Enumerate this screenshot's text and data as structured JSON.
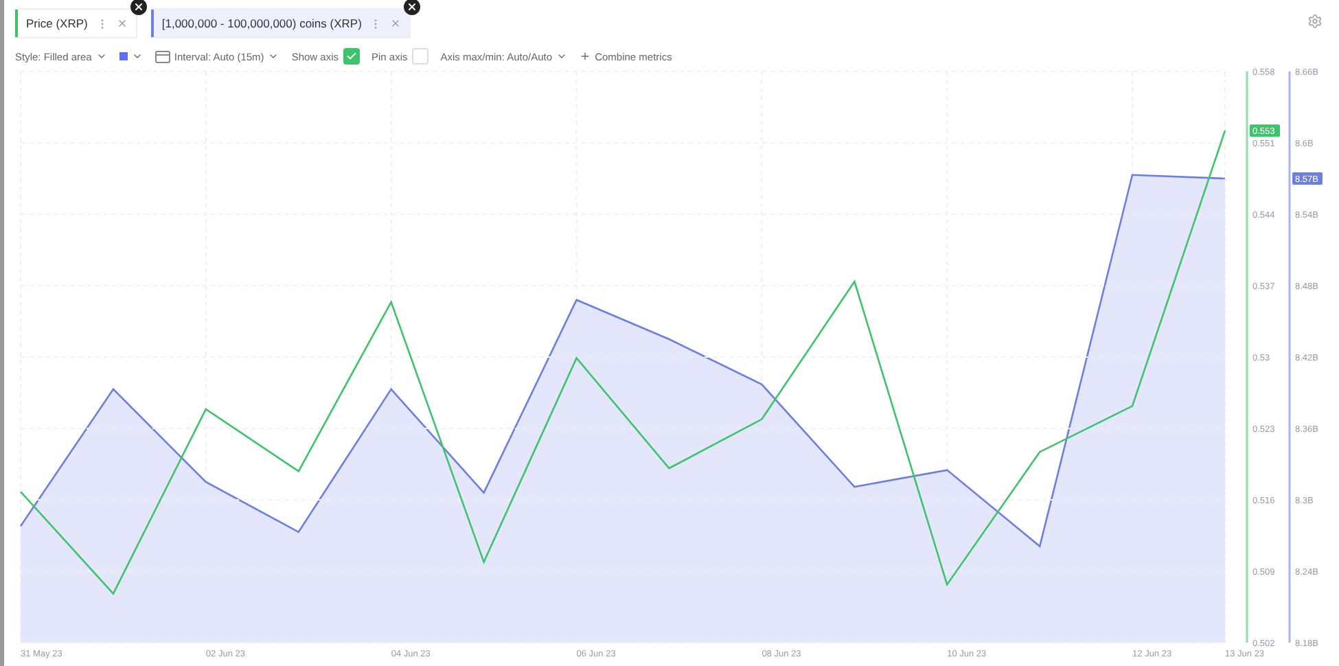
{
  "tabs": [
    {
      "label": "Price (XRP)",
      "selected": false,
      "color": "#3dc46b"
    },
    {
      "label": "[1,000,000 - 100,000,000) coins (XRP)",
      "selected": true,
      "color": "#6b7fe0"
    }
  ],
  "toolbar": {
    "style": "Style: Filled area",
    "color_swatch": {
      "color": "#5b6ff0"
    },
    "interval": "Interval: Auto (15m)",
    "show_axis": {
      "label": "Show axis",
      "checked": true
    },
    "pin_axis": {
      "label": "Pin axis",
      "checked": false
    },
    "axis_range": "Axis max/min: Auto/Auto",
    "combine": "Combine metrics"
  },
  "coins_chart": {
    "last_value_label": "8.57B",
    "chart_data": {
      "type": "area",
      "grid": true,
      "categories": [
        "31 May 23",
        null,
        "02 Jun 23",
        null,
        "04 Jun 23",
        null,
        "06 Jun 23",
        null,
        "08 Jun 23",
        null,
        "10 Jun 23",
        null,
        "12 Jun 23",
        "13 Jun 23"
      ],
      "ylim": [
        8.18,
        8.66
      ],
      "yticks": [
        {
          "value": 8.66,
          "label": "8.66B"
        },
        {
          "value": 8.6,
          "label": "8.6B"
        },
        {
          "value": 8.54,
          "label": "8.54B"
        },
        {
          "value": 8.48,
          "label": "8.48B"
        },
        {
          "value": 8.42,
          "label": "8.42B"
        },
        {
          "value": 8.36,
          "label": "8.36B"
        },
        {
          "value": 8.3,
          "label": "8.3B"
        },
        {
          "value": 8.24,
          "label": "8.24B"
        },
        {
          "value": 8.18,
          "label": "8.18B"
        }
      ],
      "series": [
        {
          "color": "#6b7fe0",
          "values": [
            8.278,
            8.393,
            8.315,
            8.273,
            8.393,
            8.306,
            8.468,
            8.435,
            8.397,
            8.311,
            8.325,
            8.261,
            8.573,
            8.57
          ]
        }
      ]
    }
  },
  "price_chart": {
    "last_value_label": "0.553",
    "chart_data": {
      "type": "line",
      "grid": true,
      "ylim": [
        0.502,
        0.558
      ],
      "yticks": [
        {
          "value": 0.558,
          "label": "0.558"
        },
        {
          "value": 0.551,
          "label": "0.551"
        },
        {
          "value": 0.544,
          "label": "0.544"
        },
        {
          "value": 0.537,
          "label": "0.537"
        },
        {
          "value": 0.53,
          "label": "0.53"
        },
        {
          "value": 0.523,
          "label": "0.523"
        },
        {
          "value": 0.516,
          "label": "0.516"
        },
        {
          "value": 0.509,
          "label": "0.509"
        },
        {
          "value": 0.502,
          "label": "0.502"
        }
      ],
      "series": [
        {
          "color": "#3dc46b",
          "values": [
            0.5168,
            0.5068,
            0.5249,
            0.5188,
            0.5354,
            0.5099,
            0.5299,
            0.5191,
            0.5239,
            0.5374,
            0.5077,
            0.5207,
            0.5252,
            0.5522
          ]
        }
      ]
    }
  }
}
